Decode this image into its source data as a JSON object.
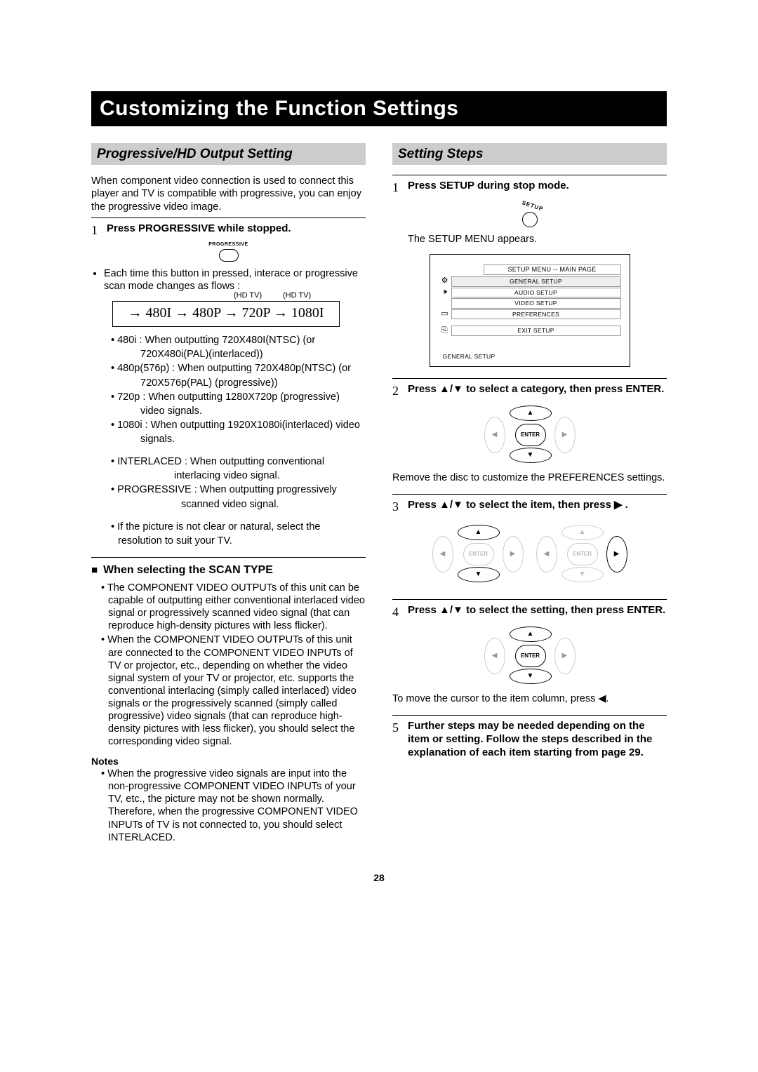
{
  "title": "Customizing the Function Settings",
  "page_number": "28",
  "left": {
    "section_title": "Progressive/HD Output Setting",
    "intro": "When component video connection is used to connect this player and TV is compatible with progressive, you can enjoy the progressive video image.",
    "step1_num": "1",
    "step1_text": "Press PROGRESSIVE while stopped.",
    "btn_label": "PROGRESSIVE",
    "bullet1": "Each time this button in pressed, interace or progressive scan mode changes as flows :",
    "hdtv_label": "(HD TV)",
    "flow_text": "→ 480I → 480P  →  720P → 1080I",
    "res1": "• 480i : When outputting 720X480I(NTSC) (or",
    "res1b": "720X480i(PAL)(interlaced))",
    "res2": "• 480p(576p) : When outputting 720X480p(NTSC) (or",
    "res2b": "720X576p(PAL) (progressive))",
    "res3": "• 720p : When outputting 1280X720p (progressive)",
    "res3b": "video signals.",
    "res4": "• 1080i : When outputting 1920X1080i(interlaced) video",
    "res4b": "signals.",
    "res5": "• INTERLACED : When outputting conventional",
    "res5b": "interlacing video signal.",
    "res6": "• PROGRESSIVE : When outputting progressively",
    "res6b": "scanned video signal.",
    "res7": "• If the picture is not clear or natural, select the",
    "res7b": "resolution to suit your TV.",
    "scan_type_hdr": "When selecting the SCAN TYPE",
    "scan1": "The COMPONENT VIDEO OUTPUTs of this unit can be capable of outputting either conventional interlaced video signal or progressively scanned video signal (that can reproduce high-density pictures with less flicker).",
    "scan2": "When the COMPONENT VIDEO OUTPUTs of this unit are connected to the COMPONENT VIDEO INPUTs of TV or projector, etc., depending on whether the video signal system of your TV or projector, etc. supports the conventional interlacing (simply called interlaced) video signals or the progressively scanned (simply called progressive)  video signals (that can reproduce high-density pictures with less flicker), you should select the corresponding video signal.",
    "notes_hdr": "Notes",
    "note1": "When the progressive video signals are input into the non-progressive COMPONENT VIDEO INPUTs of your TV, etc., the picture may not be  shown normally. Therefore, when the progressive COMPONENT VIDEO INPUTs of TV is not connected to, you should select INTERLACED."
  },
  "right": {
    "section_title": "Setting Steps",
    "step1_num": "1",
    "step1_text": "Press SETUP during stop mode.",
    "setup_label": "SETUP",
    "appear_text": "The SETUP MENU appears.",
    "menu_title": "SETUP MENU -- MAIN PAGE",
    "menu_items": [
      "GENERAL SETUP",
      "AUDIO SETUP",
      "VIDEO SETUP",
      "PREFERENCES",
      "EXIT SETUP"
    ],
    "menu_footer": "GENERAL SETUP",
    "step2_num": "2",
    "step2_text": "Press ▲/▼  to select a category, then press ENTER.",
    "enter_label": "ENTER",
    "remove_text": "Remove the disc to customize the PREFERENCES settings.",
    "step3_num": "3",
    "step3_text": "Press ▲/▼  to select the item, then press  ▶ .",
    "step4_num": "4",
    "step4_text": "Press ▲/▼  to select the setting, then press ENTER.",
    "cursor_text": "To move the cursor to the item column, press ◀.",
    "step5_num": "5",
    "step5_text": "Further steps may be needed depending on the item or setting. Follow the steps described in the explanation of each item starting from page 29."
  }
}
